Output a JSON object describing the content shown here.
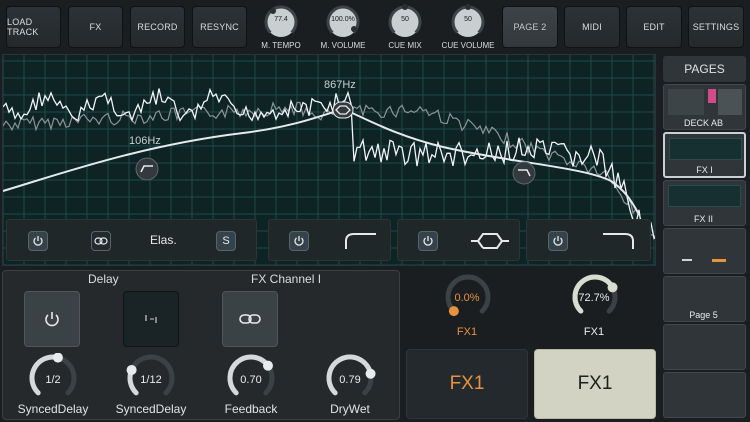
{
  "topbar": {
    "buttons": [
      "LOAD TRACK",
      "FX",
      "RECORD",
      "RESYNC"
    ],
    "knobs": [
      {
        "label": "M. TEMPO",
        "value": "77.4"
      },
      {
        "label": "M. VOLUME",
        "value": "100.0%"
      },
      {
        "label": "CUE MIX",
        "value": "50"
      },
      {
        "label": "CUE VOLUME",
        "value": "50"
      }
    ],
    "right_buttons": [
      "PAGE 2",
      "MIDI",
      "EDIT",
      "SETTINGS"
    ],
    "active_button": "PAGE 2"
  },
  "eq": {
    "low_freq": "106Hz",
    "mid_freq": "867Hz",
    "elastic_label": "Elas.",
    "solo_label": "S",
    "grid_color": "#1f4a4b",
    "curve_color": "#e6e9eb"
  },
  "delay": {
    "title": "Delay",
    "channel": "FX Channel I",
    "knobs": [
      {
        "label": "SyncedDelay",
        "value": "1/2",
        "level": 0.55
      },
      {
        "label": "SyncedDelay",
        "value": "1/12",
        "level": 0.25
      },
      {
        "label": "Feedback",
        "value": "0.70",
        "level": 0.7
      },
      {
        "label": "DryWet",
        "value": "0.79",
        "level": 0.79
      }
    ]
  },
  "fx": {
    "knob_left": {
      "value": "0.0%",
      "label": "FX1",
      "level": 0.0,
      "color": "#e8923e"
    },
    "knob_right": {
      "value": "72.7%",
      "label": "FX1",
      "level": 0.727,
      "color": "#d9ddd0"
    },
    "button_left": "FX1",
    "button_right": "FX1",
    "accent_color": "#e8923e",
    "active_fill": "#d3d3c4"
  },
  "pages": {
    "header": "PAGES",
    "items": [
      {
        "label": "DECK AB"
      },
      {
        "label": "FX I"
      },
      {
        "label": "FX II"
      },
      {
        "label": ""
      },
      {
        "label": "Page 5"
      },
      {
        "label": ""
      },
      {
        "label": ""
      }
    ],
    "selected": "FX I"
  }
}
